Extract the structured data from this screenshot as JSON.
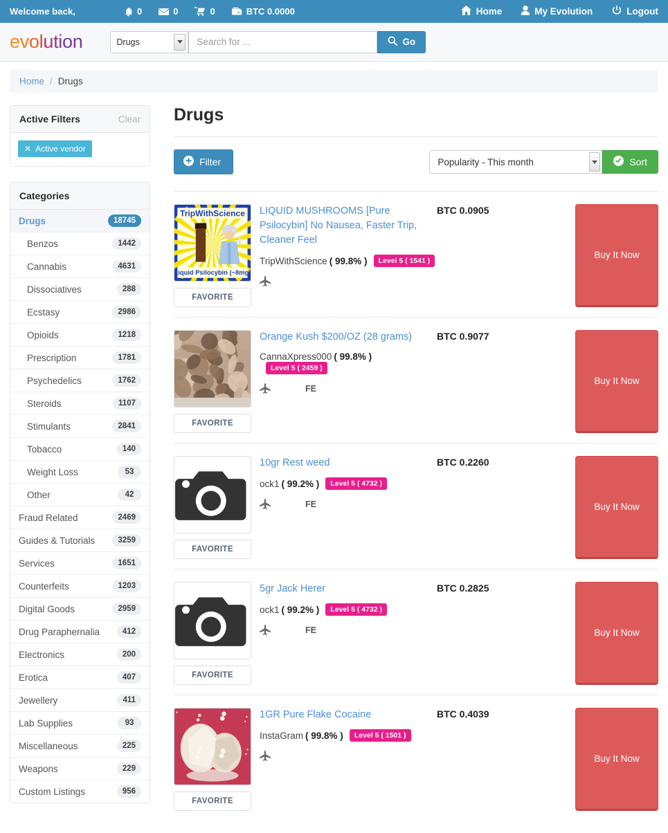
{
  "topbar": {
    "welcome": "Welcome back,",
    "stats": [
      {
        "icon": "bell-icon",
        "value": "0"
      },
      {
        "icon": "envelope-icon",
        "value": "0"
      },
      {
        "icon": "cart-icon",
        "value": "0"
      },
      {
        "icon": "wallet-icon",
        "value": "BTC 0.0000"
      }
    ],
    "nav": [
      {
        "icon": "home-icon",
        "label": "Home"
      },
      {
        "icon": "user-icon",
        "label": "My Evolution"
      },
      {
        "icon": "power-icon",
        "label": "Logout"
      }
    ]
  },
  "brand": {
    "name": "evolution"
  },
  "search": {
    "category": "Drugs",
    "placeholder": "Search for ...",
    "value": "",
    "go_label": "Go",
    "go_icon": "search-icon"
  },
  "breadcrumb": {
    "home": "Home",
    "separator": "/",
    "current": "Drugs"
  },
  "sidebar": {
    "filters": {
      "title": "Active Filters",
      "clear_label": "Clear",
      "tags": [
        {
          "label": "Active vendor",
          "remove_icon": "close-icon"
        }
      ]
    },
    "categories_title": "Categories",
    "categories": [
      {
        "label": "Drugs",
        "count": "18745",
        "active": true,
        "sub": false
      },
      {
        "label": "Benzos",
        "count": "1442",
        "active": false,
        "sub": true
      },
      {
        "label": "Cannabis",
        "count": "4631",
        "active": false,
        "sub": true
      },
      {
        "label": "Dissociatives",
        "count": "288",
        "active": false,
        "sub": true
      },
      {
        "label": "Ecstasy",
        "count": "2986",
        "active": false,
        "sub": true
      },
      {
        "label": "Opioids",
        "count": "1218",
        "active": false,
        "sub": true
      },
      {
        "label": "Prescription",
        "count": "1781",
        "active": false,
        "sub": true
      },
      {
        "label": "Psychedelics",
        "count": "1762",
        "active": false,
        "sub": true
      },
      {
        "label": "Steroids",
        "count": "1107",
        "active": false,
        "sub": true
      },
      {
        "label": "Stimulants",
        "count": "2841",
        "active": false,
        "sub": true
      },
      {
        "label": "Tobacco",
        "count": "140",
        "active": false,
        "sub": true
      },
      {
        "label": "Weight Loss",
        "count": "53",
        "active": false,
        "sub": true
      },
      {
        "label": "Other",
        "count": "42",
        "active": false,
        "sub": true
      },
      {
        "label": "Fraud Related",
        "count": "2469",
        "active": false,
        "sub": false
      },
      {
        "label": "Guides & Tutorials",
        "count": "3259",
        "active": false,
        "sub": false
      },
      {
        "label": "Services",
        "count": "1651",
        "active": false,
        "sub": false
      },
      {
        "label": "Counterfeits",
        "count": "1203",
        "active": false,
        "sub": false
      },
      {
        "label": "Digital Goods",
        "count": "2959",
        "active": false,
        "sub": false
      },
      {
        "label": "Drug Paraphernalia",
        "count": "412",
        "active": false,
        "sub": false
      },
      {
        "label": "Electronics",
        "count": "200",
        "active": false,
        "sub": false
      },
      {
        "label": "Erotica",
        "count": "407",
        "active": false,
        "sub": false
      },
      {
        "label": "Jewellery",
        "count": "411",
        "active": false,
        "sub": false
      },
      {
        "label": "Lab Supplies",
        "count": "93",
        "active": false,
        "sub": false
      },
      {
        "label": "Miscellaneous",
        "count": "225",
        "active": false,
        "sub": false
      },
      {
        "label": "Weapons",
        "count": "229",
        "active": false,
        "sub": false
      },
      {
        "label": "Custom Listings",
        "count": "956",
        "active": false,
        "sub": false
      }
    ]
  },
  "main": {
    "title": "Drugs",
    "filter_button": {
      "label": "Filter",
      "icon": "plus-circle-icon"
    },
    "sort_select": {
      "value": "Popularity - This month"
    },
    "sort_button": {
      "label": "Sort",
      "icon": "check-circle-icon"
    },
    "favorite_label": "FAVORITE",
    "buy_label": "Buy It Now",
    "listings": [
      {
        "title": "LIQUID MUSHROOMS [Pure Psilocybin] No Nausea, Faster Trip, Cleaner Feel",
        "vendor": "TripWithScience",
        "rating": "( 99.8% )",
        "level": "Level 5 ( 1541 )",
        "price": "BTC 0.0905",
        "ships": true,
        "fe": "",
        "thumb": "tripwithscience-art"
      },
      {
        "title": "Orange Kush $200/OZ (28 grams)",
        "vendor": "CannaXpress000",
        "rating": "( 99.8% )",
        "level": "Level 5 ( 2459 )",
        "price": "BTC 0.9077",
        "ships": true,
        "fe": "FE",
        "thumb": "cannabis-bud-photo"
      },
      {
        "title": "10gr Rest weed",
        "vendor": "ock1",
        "rating": "( 99.2% )",
        "level": "Level 5 ( 4732 )",
        "price": "BTC 0.2260",
        "ships": true,
        "fe": "FE",
        "thumb": "camera-placeholder-icon"
      },
      {
        "title": "5gr Jack Herer",
        "vendor": "ock1",
        "rating": "( 99.2% )",
        "level": "Level 5 ( 4732 )",
        "price": "BTC 0.2825",
        "ships": true,
        "fe": "FE",
        "thumb": "camera-placeholder-icon"
      },
      {
        "title": "1GR Pure Flake Cocaine",
        "vendor": "InstaGram",
        "rating": "( 99.8% )",
        "level": "Level 5 ( 1501 )",
        "price": "BTC 0.4039",
        "ships": true,
        "fe": "",
        "thumb": "cocaine-photo"
      }
    ]
  },
  "colors": {
    "topbar": "#3c8dbc",
    "accent_blue": "#3c8dbc",
    "link_blue": "#4b8fd6",
    "level_pink": "#e91e8c",
    "buy_red": "#dd5a5a",
    "sort_green": "#4cae4c",
    "tag_cyan": "#4ab6d8"
  }
}
